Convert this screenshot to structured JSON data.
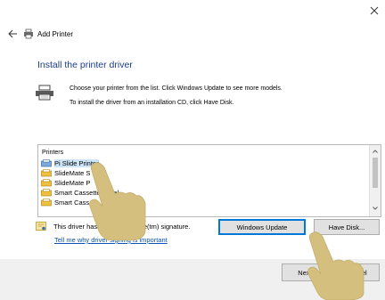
{
  "dialog": {
    "title": "Add Printer",
    "heading": "Install the printer driver",
    "instruction_line1": "Choose your printer from the list. Click Windows Update to see more models.",
    "instruction_line2": "To install the driver from an installation CD, click Have Disk."
  },
  "printer_list": {
    "header": "Printers",
    "items": [
      {
        "label": "Pi Slide Printer",
        "selected": true
      },
      {
        "label": "SlideMate S",
        "selected": false
      },
      {
        "label": "SlideMate P",
        "selected": false
      },
      {
        "label": "Smart Cassette Label",
        "selected": false
      },
      {
        "label": "Smart Cass",
        "selected": false
      }
    ]
  },
  "signature": {
    "text": "This driver has an Authenticode(tm) signature.",
    "link": "Tell me why driver signing is important"
  },
  "buttons": {
    "windows_update": "Windows Update",
    "have_disk": "Have Disk...",
    "next": "Next",
    "cancel": "Cancel"
  },
  "colors": {
    "heading": "#1a3c8a",
    "link": "#0a52b8",
    "selection": "#cce4f7",
    "accent": "#0078d7",
    "hand": "#d4bf7f"
  },
  "icons": {
    "close": "close-icon",
    "back": "back-arrow-icon",
    "printer": "printer-icon",
    "signature": "certificate-icon",
    "hand": "pointing-hand-icon"
  }
}
